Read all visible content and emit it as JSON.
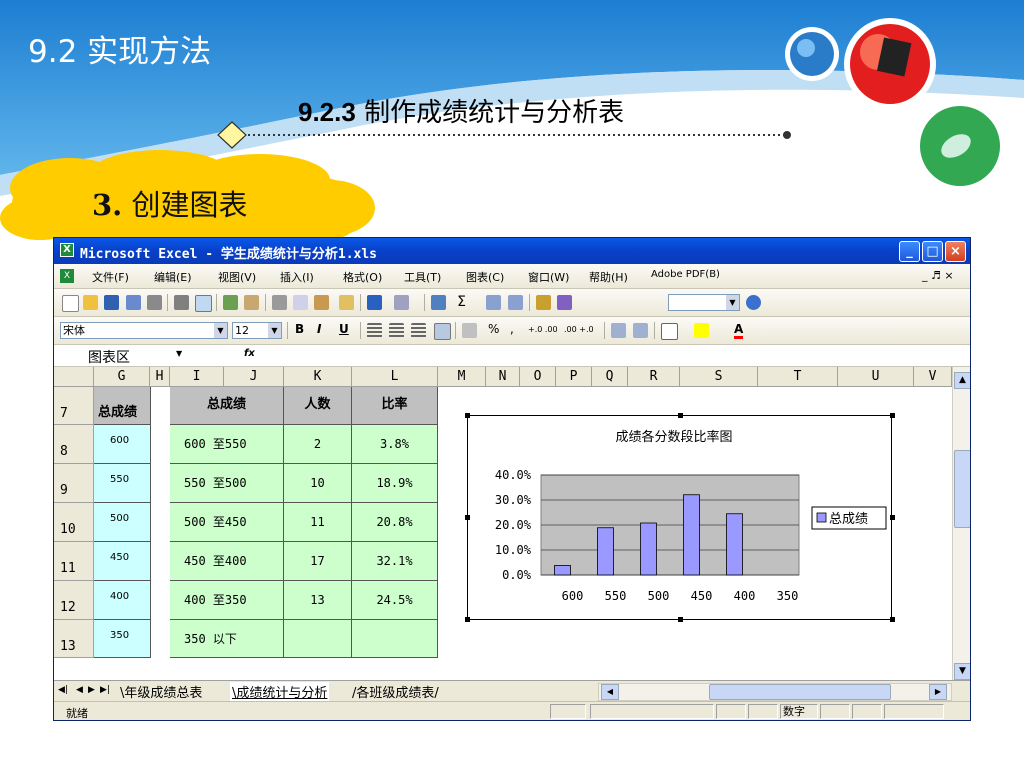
{
  "slide": {
    "section_title": "9.2  实现方法",
    "subtitle_number": "9.2.3",
    "subtitle_text": "  制作成绩统计与分析表",
    "cloud_number": "3.",
    "cloud_text": " 创建图表"
  },
  "window": {
    "title": "Microsoft Excel - 学生成绩统计与分析1.xls",
    "buttons": [
      "_",
      "□",
      "×"
    ]
  },
  "menu": {
    "items": [
      "文件(F)",
      "编辑(E)",
      "视图(V)",
      "插入(I)",
      "格式(O)",
      "工具(T)",
      "图表(C)",
      "窗口(W)",
      "帮助(H)",
      "Adobe PDF(B)"
    ],
    "doc_controls": "_ ♬ ×"
  },
  "toolbar": {
    "font": "宋体",
    "size": "12",
    "bold": "B",
    "italic": "I",
    "underline": "U",
    "percent": "%",
    "comma": ",",
    "dec_inc": "+.0 .00",
    "dec_dec": ".00 +.0",
    "font_color": "A"
  },
  "formula_bar": {
    "name_box": "图表区",
    "fx": "fx"
  },
  "columns": [
    "G",
    "H",
    "I",
    "J",
    "K",
    "L",
    "M",
    "N",
    "O",
    "P",
    "Q",
    "R",
    "S",
    "T",
    "U",
    "V"
  ],
  "rows": [
    "7",
    "8",
    "9",
    "10",
    "11",
    "12",
    "13"
  ],
  "table": {
    "g_header": "总成绩",
    "g_values": [
      "600",
      "550",
      "500",
      "450",
      "400",
      "350",
      ""
    ],
    "headers": [
      "总成绩",
      "人数",
      "比率"
    ],
    "data": [
      [
        "600 至550",
        "2",
        "3.8%"
      ],
      [
        "550 至500",
        "10",
        "18.9%"
      ],
      [
        "500 至450",
        "11",
        "20.8%"
      ],
      [
        "450 至400",
        "17",
        "32.1%"
      ],
      [
        "400 至350",
        "13",
        "24.5%"
      ],
      [
        "350 以下",
        "",
        ""
      ],
      [
        "",
        "",
        ""
      ]
    ]
  },
  "chart_data": {
    "type": "bar",
    "title": "成绩各分数段比率图",
    "categories": [
      "600",
      "550",
      "500",
      "450",
      "400",
      "350"
    ],
    "series": [
      {
        "name": "总成绩",
        "values": [
          3.8,
          18.9,
          20.8,
          32.1,
          24.5,
          0
        ]
      }
    ],
    "y_tick_labels": [
      "40.0%",
      "30.0%",
      "20.0%",
      "10.0%",
      "0.0%"
    ],
    "ylim": [
      0,
      40
    ],
    "grid": true,
    "legend": "right",
    "colors": {
      "bar": "#9999ff",
      "plot_bg": "#c0c0c0"
    }
  },
  "sheet_tabs": {
    "items": [
      "年级成绩总表",
      "成绩统计与分析",
      "各班级成绩表"
    ],
    "active": 1
  },
  "status": {
    "ready": "就绪",
    "num": "数字"
  },
  "colors": {
    "banner": "#2e8fd6",
    "cloud": "#ffcc00",
    "title_blue": "#0a58e8"
  }
}
